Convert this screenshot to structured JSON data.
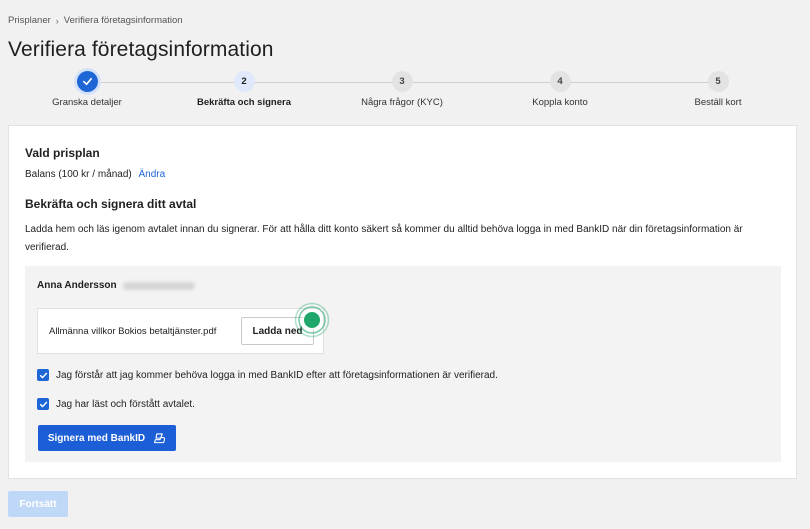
{
  "breadcrumb": {
    "items": [
      "Prisplaner",
      "Verifiera företagsinformation"
    ]
  },
  "page": {
    "title": "Verifiera företagsinformation"
  },
  "stepper": {
    "steps": [
      {
        "number": "",
        "label": "Granska detaljer",
        "state": "done"
      },
      {
        "number": "2",
        "label": "Bekräfta och signera",
        "state": "active"
      },
      {
        "number": "3",
        "label": "Några frågor (KYC)",
        "state": "pending"
      },
      {
        "number": "4",
        "label": "Koppla konto",
        "state": "pending"
      },
      {
        "number": "5",
        "label": "Beställ kort",
        "state": "pending"
      }
    ]
  },
  "plan": {
    "heading": "Vald prisplan",
    "value": "Balans (100 kr / månad)",
    "change_link": "Ändra"
  },
  "agreement": {
    "heading": "Bekräfta och signera ditt avtal",
    "description": "Ladda hem och läs igenom avtalet innan du signerar. För att hålla ditt konto säkert så kommer du alltid behöva logga in med BankID när din företagsinformation är verifierad.",
    "signer_name": "Anna Andersson",
    "document_name": "Allmänna villkor Bokios betaltjänster.pdf",
    "download_label": "Ladda ned",
    "checkbox_bankid": "Jag förstår att jag kommer behöva logga in med BankID efter att företagsinformationen är verifierad.",
    "checkbox_read": "Jag har läst och förstått avtalet.",
    "sign_button": "Signera med BankID"
  },
  "footer": {
    "continue_label": "Fortsätt"
  },
  "colors": {
    "accent": "#1e66d6",
    "pulse": "#1fa66a",
    "disabled": "#bfd8f7"
  }
}
